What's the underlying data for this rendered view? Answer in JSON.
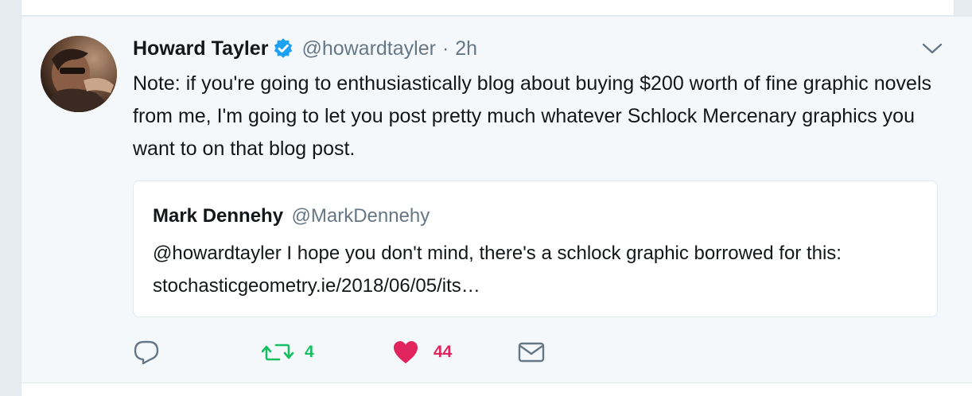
{
  "tweet": {
    "author": {
      "name": "Howard Tayler",
      "handle": "@howardtayler",
      "verified": true
    },
    "separator": "·",
    "time": "2h",
    "text": "Note: if you're going to enthusiastically blog about buying $200 worth of fine graphic novels from me, I'm going to let you post pretty much whatever Schlock Mercenary graphics you want to on that blog post.",
    "quoted": {
      "name": "Mark Dennehy",
      "handle": "@MarkDennehy",
      "text": "@howardtayler I hope you don't mind, there's a schlock graphic borrowed for this: stochasticgeometry.ie/2018/06/05/its…"
    },
    "actions": {
      "reply_icon": "reply-icon",
      "retweet_icon": "retweet-icon",
      "retweet_count": "4",
      "like_icon": "heart-icon",
      "like_count": "44",
      "dm_icon": "envelope-icon"
    }
  },
  "colors": {
    "background": "#f5f8fa",
    "verified_blue": "#1da1f2",
    "retweet_green": "#17bf63",
    "like_red": "#e0245e",
    "secondary_gray": "#657786",
    "text": "#14171a"
  }
}
